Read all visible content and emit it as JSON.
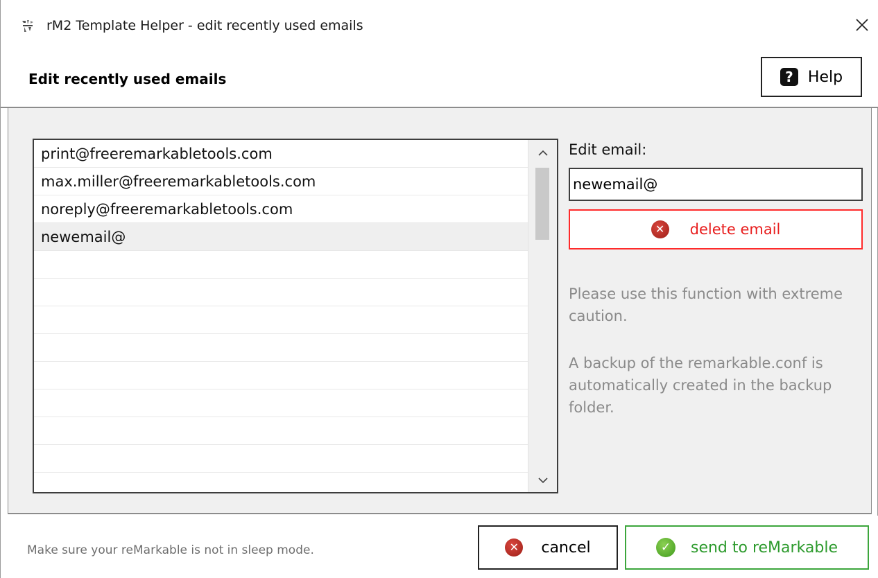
{
  "window": {
    "title": "rM2 Template Helper - edit recently used emails",
    "app_icon": "app-logo-icon",
    "close_icon": "close-icon"
  },
  "header": {
    "title": "Edit recently used emails",
    "help_label": "Help",
    "help_icon": "question-mark-icon"
  },
  "email_list": {
    "items": [
      "print@freeremarkabletools.com",
      "max.miller@freeremarkabletools.com",
      "noreply@freeremarkabletools.com",
      "newemail@"
    ],
    "selected_index": 3,
    "scroll_up_icon": "chevron-up-icon",
    "scroll_down_icon": "chevron-down-icon"
  },
  "editor": {
    "label": "Edit email:",
    "value": "newemail@",
    "delete_label": "delete email",
    "delete_icon": "x-circle-icon",
    "warning_text": "Please use this function with extreme caution.",
    "backup_text": "A backup of the remarkable.conf is automatically created in the backup folder."
  },
  "footer": {
    "note": "Make sure your reMarkable is not in sleep mode.",
    "cancel_label": "cancel",
    "cancel_icon": "x-circle-icon",
    "send_label": "send to reMarkable",
    "send_icon": "check-circle-icon"
  },
  "colors": {
    "delete_border": "#ff2a2a",
    "delete_text": "#e81e1e",
    "send_border": "#3ca63c",
    "send_text": "#2c9a2c",
    "info_text": "#8a8a8a",
    "panel_background": "#f0f0f0"
  }
}
